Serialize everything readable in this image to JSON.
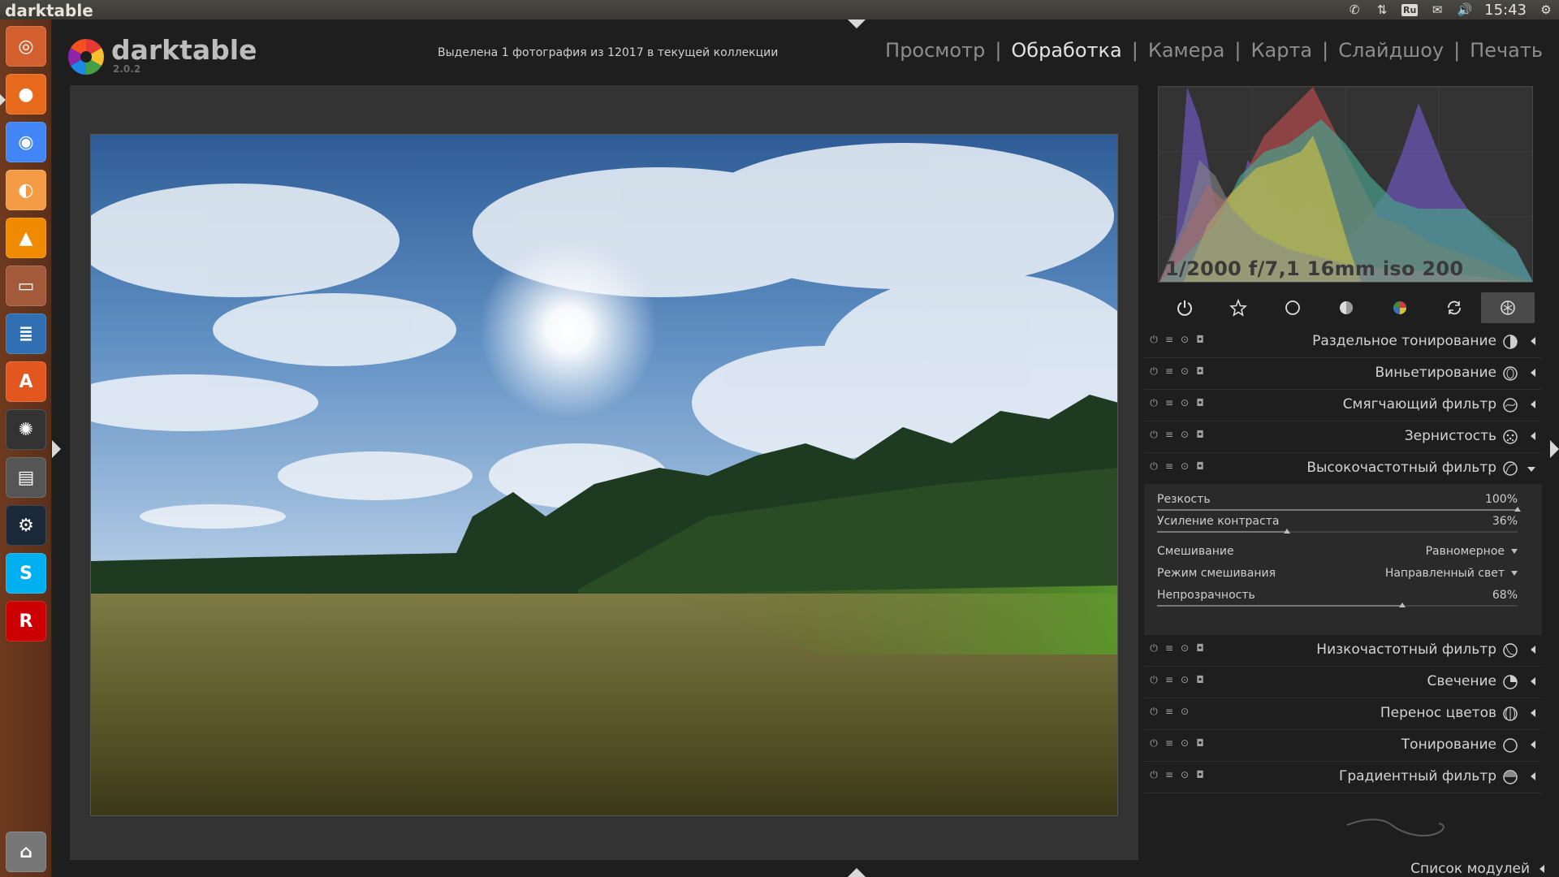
{
  "panel": {
    "app_name": "darktable",
    "keyboard_layout": "Ru",
    "clock": "15:43"
  },
  "launcher": {
    "items": [
      {
        "name": "ubuntu-dash-icon",
        "color": "#d35f2e"
      },
      {
        "name": "firefox-icon",
        "color": "#e76a1c"
      },
      {
        "name": "chrome-icon",
        "color": "#4285f4"
      },
      {
        "name": "orange-app-icon",
        "color": "#f39c45"
      },
      {
        "name": "vlc-icon",
        "color": "#f08a00"
      },
      {
        "name": "files-icon",
        "color": "#a35a3a"
      },
      {
        "name": "writer-icon",
        "color": "#2f6fb2"
      },
      {
        "name": "software-center-icon",
        "color": "#e2571f"
      },
      {
        "name": "darktable-icon",
        "color": "#333333"
      },
      {
        "name": "scanner-icon",
        "color": "#555555"
      },
      {
        "name": "steam-icon",
        "color": "#1b2838"
      },
      {
        "name": "skype-icon",
        "color": "#00aff0"
      },
      {
        "name": "rosa-icon",
        "color": "#cc0000"
      },
      {
        "name": "trash-icon",
        "color": "#777777"
      }
    ]
  },
  "header": {
    "logo_text": "darktable",
    "version": "2.0.2",
    "status": "Выделена 1 фотография из 12017 в текущей коллекции",
    "views": [
      "Просмотр",
      "Обработка",
      "Камера",
      "Карта",
      "Слайдшоу",
      "Печать"
    ],
    "active_view": "Обработка",
    "separator": "|"
  },
  "histogram": {
    "exif": "1/2000 f/7,1 16mm iso 200"
  },
  "module_groups": [
    {
      "name": "power-icon"
    },
    {
      "name": "favorite-star-icon"
    },
    {
      "name": "basic-group-icon"
    },
    {
      "name": "tone-group-icon"
    },
    {
      "name": "color-group-icon"
    },
    {
      "name": "correct-group-icon"
    },
    {
      "name": "effects-group-icon",
      "selected": true
    }
  ],
  "modules_before": [
    {
      "name": "Раздельное тонирование",
      "icon": "split-toning-icon"
    },
    {
      "name": "Виньетирование",
      "icon": "vignette-icon"
    },
    {
      "name": "Смягчающий фильтр",
      "icon": "soften-icon"
    },
    {
      "name": "Зернистость",
      "icon": "grain-icon"
    }
  ],
  "expanded_module": {
    "name": "Высокочастотный фильтр",
    "icon": "highpass-icon",
    "params": {
      "sharpness_label": "Резкость",
      "sharpness_value": "100%",
      "sharpness_fraction": 1.0,
      "contrast_label": "Усиление контраста",
      "contrast_value": "36%",
      "contrast_fraction": 0.36,
      "blend_label": "Смешивание",
      "blend_value": "Равномерное",
      "blend_mode_label": "Режим смешивания",
      "blend_mode_value": "Направленный свет",
      "opacity_label": "Непрозрачность",
      "opacity_value": "68%",
      "opacity_fraction": 0.68
    }
  },
  "modules_after": [
    {
      "name": "Низкочастотный фильтр",
      "icon": "lowpass-icon"
    },
    {
      "name": "Свечение",
      "icon": "bloom-icon"
    },
    {
      "name": "Перенос цветов",
      "icon": "color-transfer-icon"
    },
    {
      "name": "Тонирование",
      "icon": "toning-icon"
    },
    {
      "name": "Градиентный фильтр",
      "icon": "graduated-filter-icon"
    }
  ],
  "footer": {
    "module_list": "Список модулей"
  }
}
